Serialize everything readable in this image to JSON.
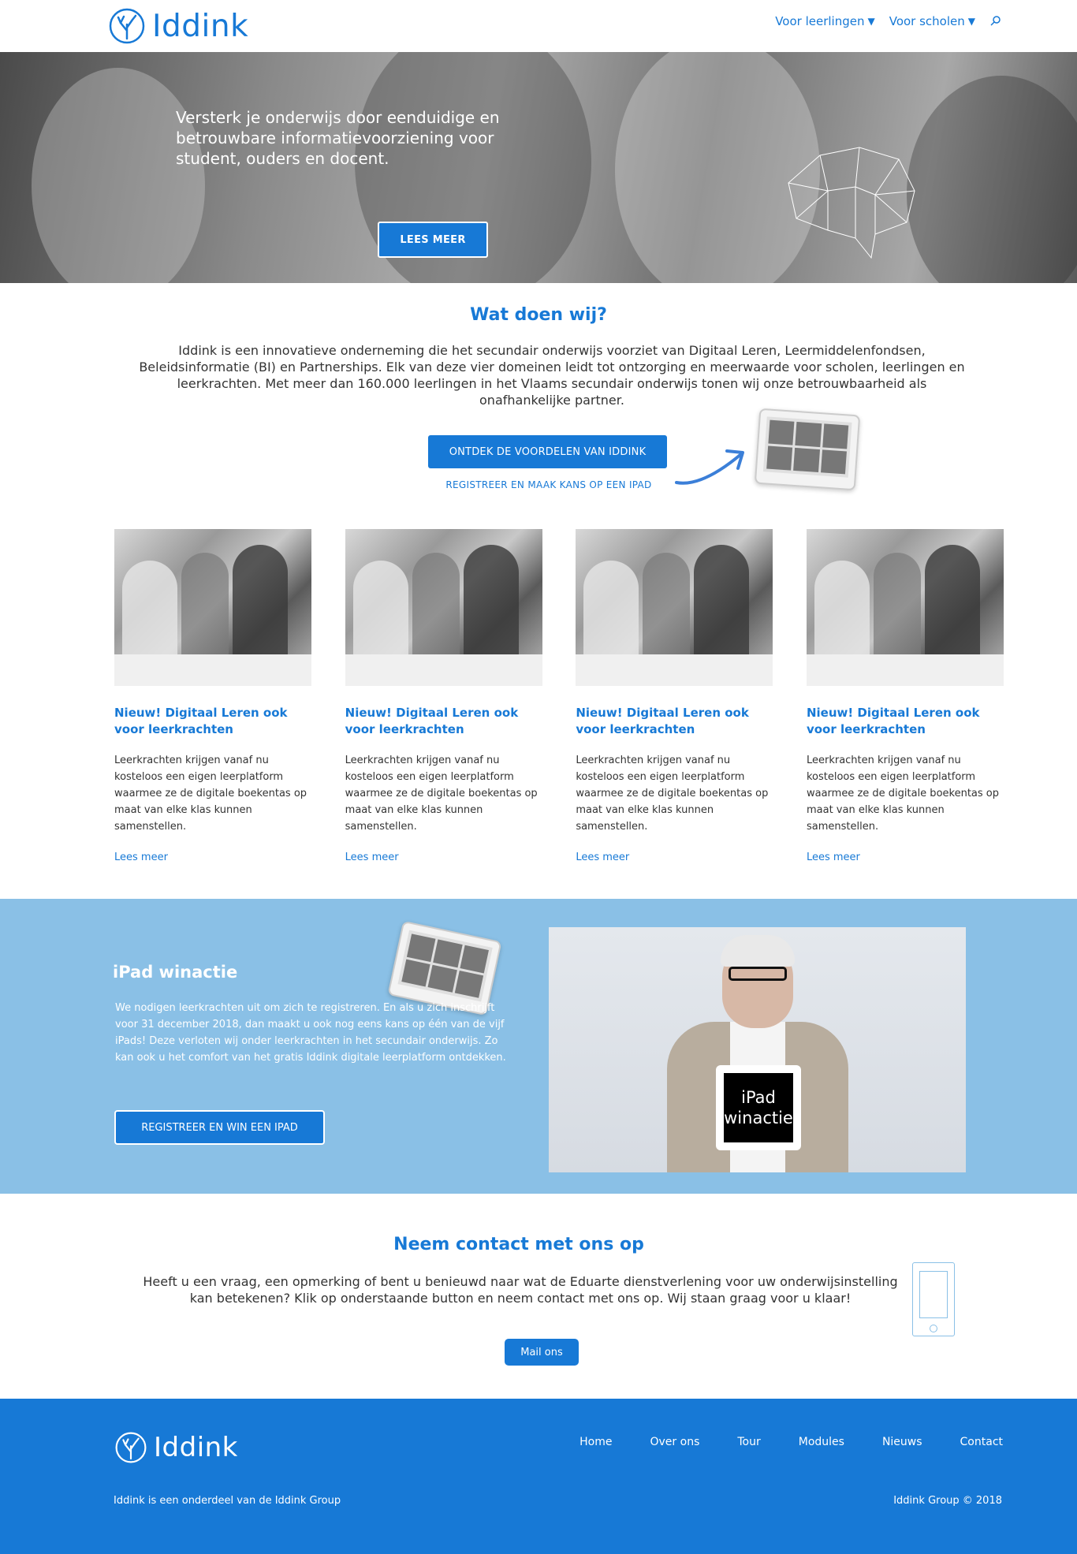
{
  "header": {
    "brand": "Iddink",
    "nav": [
      {
        "label": "Voor leerlingen",
        "caret": "▼"
      },
      {
        "label": "Voor scholen",
        "caret": "▼"
      }
    ],
    "search_icon": "search-icon"
  },
  "hero": {
    "text": "Versterk je onderwijs door eenduidige en betrouwbare informatievoorziening voor student, ouders en docent.",
    "button": "LEES MEER"
  },
  "about": {
    "title": "Wat doen wij?",
    "text": "Iddink is een innovatieve onderneming die het secundair onderwijs voorziet van Digitaal Leren, Leermiddelenfondsen, Beleidsinformatie (BI) en Partnerships. Elk van deze vier domeinen leidt tot ontzorging en meerwaarde voor scholen, leerlingen en leerkrachten. Met meer dan 160.000 leerlingen in het Vlaams secundair onderwijs tonen wij onze betrouwbaarheid als onafhankelijke partner.",
    "button": "ONTDEK DE VOORDELEN VAN IDDINK",
    "link": "REGISTREER EN MAAK KANS OP EEN IPAD"
  },
  "cards": [
    {
      "title": "Nieuw! Digitaal Leren ook voor leerkrachten",
      "text": "Leerkrachten krijgen vanaf nu kosteloos een eigen leerplatform waarmee ze de digitale boekentas op maat van elke klas kunnen samenstellen.",
      "link": "Lees meer"
    },
    {
      "title": "Nieuw! Digitaal Leren ook voor leerkrachten",
      "text": "Leerkrachten krijgen vanaf nu kosteloos een eigen leerplatform waarmee ze de digitale boekentas op maat van elke klas kunnen samenstellen.",
      "link": "Lees meer"
    },
    {
      "title": "Nieuw! Digitaal Leren ook voor leerkrachten",
      "text": "Leerkrachten krijgen vanaf nu kosteloos een eigen leerplatform waarmee ze de digitale boekentas op maat van elke klas kunnen samenstellen.",
      "link": "Lees meer"
    },
    {
      "title": "Nieuw! Digitaal Leren ook voor leerkrachten",
      "text": "Leerkrachten krijgen vanaf nu kosteloos een eigen leerplatform waarmee ze de digitale boekentas op maat van elke klas kunnen samenstellen.",
      "link": "Lees meer"
    }
  ],
  "ipad": {
    "title": "iPad winactie",
    "text": "We nodigen leerkrachten uit om zich te registreren. En als u zich inschrijft voor 31 december 2018, dan maakt u ook nog eens kans op één van de vijf iPads! Deze verloten wij onder leerkrachten in het secundair onderwijs. Zo kan ook u het comfort van het gratis Iddink digitale leerplatform ontdekken.",
    "button": "REGISTREER EN WIN EEN IPAD",
    "photo_sign": "iPad winactie"
  },
  "contact": {
    "title": "Neem contact met ons op",
    "text": "Heeft u een vraag, een opmerking of bent u benieuwd naar wat de Eduarte dienstverlening voor uw onderwijsinstelling kan betekenen? Klik op onderstaande button en neem contact met ons op. Wij staan graag voor u klaar!",
    "button": "Mail ons"
  },
  "footer": {
    "brand": "Iddink",
    "nav": [
      "Home",
      "Over ons",
      "Tour",
      "Modules",
      "Nieuws",
      "Contact"
    ],
    "left_text": "Iddink is een onderdeel van de Iddink Group",
    "right_text": "Iddink Group © 2018"
  },
  "colors": {
    "primary": "#1779d6",
    "light_blue": "#8ac0e6"
  }
}
